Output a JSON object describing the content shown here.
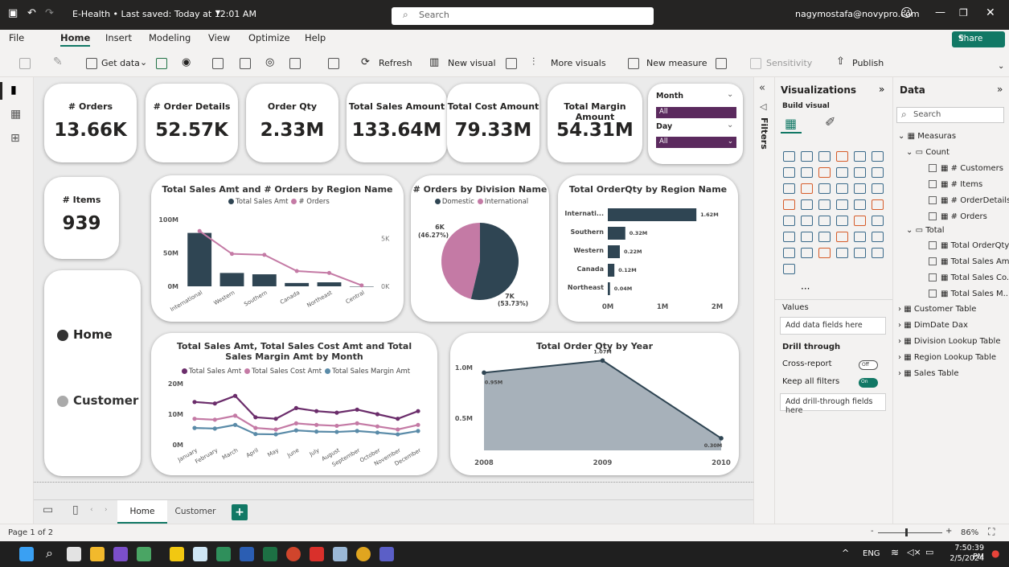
{
  "titlebar": {
    "file_title": "E-Health • Last saved: Today at 12:01 AM",
    "search": "Search",
    "user": "nagymostafa@novypro.com"
  },
  "menu": {
    "file": "File",
    "home": "Home",
    "insert": "Insert",
    "modeling": "Modeling",
    "view": "View",
    "optimize": "Optimize",
    "help": "Help",
    "share": "Share"
  },
  "ribbon": {
    "get_data": "Get data",
    "refresh": "Refresh",
    "new_visual": "New visual",
    "more_visuals": "More visuals",
    "new_measure": "New measure",
    "sensitivity": "Sensitivity",
    "publish": "Publish"
  },
  "kpis": [
    {
      "label": "# Orders",
      "value": "13.66K"
    },
    {
      "label": "# Order Details",
      "value": "52.57K"
    },
    {
      "label": "Order Qty",
      "value": "2.33M"
    },
    {
      "label": "Total Sales Amount",
      "value": "133.64M"
    },
    {
      "label": "Total Cost Amount",
      "value": "79.33M"
    },
    {
      "label": "Total Margin Amount",
      "value": "54.31M"
    }
  ],
  "items_card": {
    "label": "# Items",
    "value": "939"
  },
  "slicer": {
    "month_label": "Month",
    "month_value": "All",
    "day_label": "Day",
    "day_value": "All"
  },
  "nav_buttons": {
    "home": "Home",
    "customer": "Customer"
  },
  "colors": {
    "dark": "#2f4553",
    "pink": "#c47aa5",
    "purple": "#6b2d6b",
    "blue": "#5a8ba8",
    "accent": "#5b2a5e"
  },
  "chart_data": [
    {
      "type": "bar",
      "title": "Total Sales Amt and # Orders by Region Name",
      "series": [
        {
          "name": "Total Sales Amt",
          "values": [
            80,
            20,
            18,
            5,
            6,
            0
          ]
        },
        {
          "name": "# Orders",
          "values": [
            5.8,
            3.4,
            3.3,
            1.6,
            1.4,
            0.1
          ]
        }
      ],
      "categories": [
        "International",
        "Western",
        "Southern",
        "Canada",
        "Northeast",
        "Central"
      ],
      "y_ticks": [
        "100M",
        "50M",
        "0M"
      ],
      "y2_ticks": [
        "5K",
        "0K"
      ],
      "ylim": [
        0,
        100
      ],
      "y2lim": [
        0,
        7
      ]
    },
    {
      "type": "pie",
      "title": "# Orders by Division Name",
      "series": [
        {
          "name": "Domestic",
          "values": [
            6
          ]
        },
        {
          "name": "International",
          "values": [
            7
          ]
        }
      ],
      "labels": [
        {
          "value": "6K",
          "pct": "(46.27%)"
        },
        {
          "value": "7K",
          "pct": "(53.73%)"
        }
      ],
      "fractions": [
        0.4627,
        0.5373
      ]
    },
    {
      "type": "bar",
      "title": "Total OrderQty by Region Name",
      "categories": [
        "Internati...",
        "Southern",
        "Western",
        "Canada",
        "Northeast"
      ],
      "values": [
        1.62,
        0.32,
        0.22,
        0.12,
        0.04
      ],
      "labels": [
        "1.62M",
        "0.32M",
        "0.22M",
        "0.12M",
        "0.04M"
      ],
      "x_ticks": [
        "0M",
        "1M",
        "2M"
      ],
      "xlim": [
        0,
        2
      ]
    },
    {
      "type": "line",
      "title": "Total Sales Amt, Total Sales Cost Amt and Total Sales Margin Amt by Month",
      "categories": [
        "January",
        "February",
        "March",
        "April",
        "May",
        "June",
        "July",
        "August",
        "September",
        "October",
        "November",
        "December"
      ],
      "series": [
        {
          "name": "Total Sales Amt",
          "values": [
            14,
            13.5,
            16,
            9,
            8.5,
            12,
            11,
            10.5,
            11.5,
            10,
            8.5,
            11
          ]
        },
        {
          "name": "Total Sales Cost Amt",
          "values": [
            8.5,
            8.2,
            9.5,
            5.5,
            5,
            7,
            6.5,
            6.2,
            7,
            6,
            5,
            6.5
          ]
        },
        {
          "name": "Total Sales Margin Amt",
          "values": [
            5.5,
            5.3,
            6.5,
            3.5,
            3.4,
            4.7,
            4.3,
            4.2,
            4.5,
            4,
            3.4,
            4.5
          ]
        }
      ],
      "y_ticks": [
        "20M",
        "10M",
        "0M"
      ],
      "ylim": [
        0,
        20
      ]
    },
    {
      "type": "area",
      "title": "Total Order Qty by Year",
      "x": [
        "2008",
        "2009",
        "2010"
      ],
      "values": [
        0.95,
        1.07,
        0.3
      ],
      "labels": [
        "0.95M",
        "1.07M",
        "0.30M"
      ],
      "y_ticks": [
        "1.0M",
        "0.5M"
      ],
      "ylim": [
        0.18,
        1.12
      ]
    }
  ],
  "pagetabs": {
    "home": "Home",
    "customer": "Customer"
  },
  "filters": {
    "label": "Filters"
  },
  "viz": {
    "title": "Visualizations",
    "build": "Build visual",
    "values": "Values",
    "add_fields": "Add data fields here",
    "drill": "Drill through",
    "cross": "Cross-report",
    "cross_state": "Off",
    "keep": "Keep all filters",
    "keep_state": "On",
    "add_drill": "Add drill-through fields here"
  },
  "data_pane": {
    "title": "Data",
    "search": "Search",
    "measures": "Measuras",
    "count": "Count",
    "count_items": [
      "# Customers",
      "# Items",
      "# OrderDetails",
      "# Orders"
    ],
    "total": "Total",
    "total_items": [
      "Total OrderQty",
      "Total Sales Amt",
      "Total Sales Co...",
      "Total Sales M..."
    ],
    "tables": [
      "Customer Table",
      "DimDate Dax",
      "Division Lookup Table",
      "Region Lookup Table",
      "Sales Table"
    ]
  },
  "status": {
    "page": "Page 1 of 2",
    "zoom": "86%"
  },
  "taskbar": {
    "lang": "ENG",
    "time": "7:50:39 PM",
    "date": "2/5/2024"
  }
}
